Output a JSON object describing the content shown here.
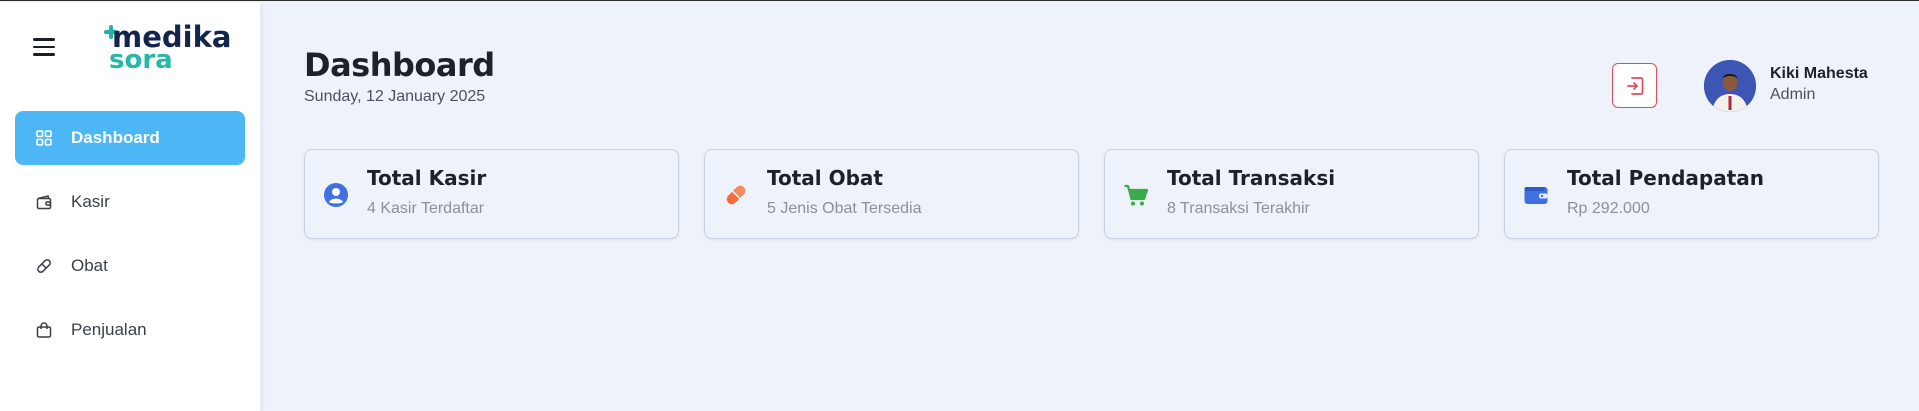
{
  "app": {
    "logo_line1": "medika",
    "logo_line2": "sora",
    "colors": {
      "accent": "#4db6f5",
      "brand_dark": "#13254b",
      "brand_teal": "#27b8a7",
      "logout_red": "#e0495c"
    }
  },
  "sidebar": {
    "menu_icon": "hamburger-icon",
    "items": [
      {
        "label": "Dashboard",
        "icon": "grid-icon",
        "active": true
      },
      {
        "label": "Kasir",
        "icon": "wallet-icon",
        "active": false
      },
      {
        "label": "Obat",
        "icon": "pill-icon",
        "active": false
      },
      {
        "label": "Penjualan",
        "icon": "bag-icon",
        "active": false
      }
    ]
  },
  "header": {
    "title": "Dashboard",
    "date": "Sunday, 12 January 2025",
    "logout_icon": "logout-icon",
    "user": {
      "name": "Kiki Mahesta",
      "role": "Admin"
    }
  },
  "cards": [
    {
      "title": "Total Kasir",
      "subtitle": "4 Kasir Terdaftar",
      "icon": "user-circle-icon",
      "color": "#3f6fe0"
    },
    {
      "title": "Total Obat",
      "subtitle": "5 Jenis Obat Tersedia",
      "icon": "pill-icon",
      "color": "#f26b3a"
    },
    {
      "title": "Total Transaksi",
      "subtitle": "8 Transaksi Terakhir",
      "icon": "cart-icon",
      "color": "#3aaa4a"
    },
    {
      "title": "Total Pendapatan",
      "subtitle": "Rp 292.000",
      "icon": "wallet-icon",
      "color": "#3f6fe0"
    }
  ]
}
